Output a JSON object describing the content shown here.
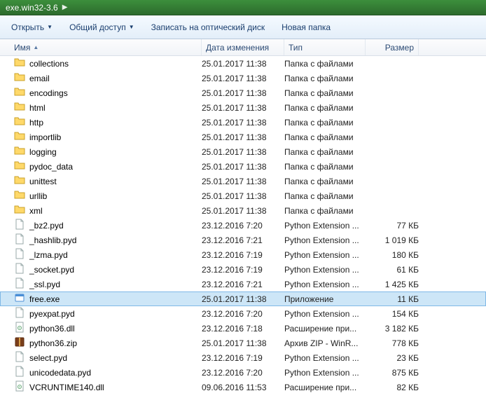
{
  "breadcrumb": {
    "current": "exe.win32-3.6"
  },
  "toolbar": {
    "open": "Открыть",
    "share": "Общий доступ",
    "burn": "Записать на оптический диск",
    "new_folder": "Новая папка"
  },
  "columns": {
    "name": "Имя",
    "date": "Дата изменения",
    "type": "Тип",
    "size": "Размер"
  },
  "rows": [
    {
      "icon": "folder",
      "name": "collections",
      "date": "25.01.2017 11:38",
      "type": "Папка с файлами",
      "size": ""
    },
    {
      "icon": "folder",
      "name": "email",
      "date": "25.01.2017 11:38",
      "type": "Папка с файлами",
      "size": ""
    },
    {
      "icon": "folder",
      "name": "encodings",
      "date": "25.01.2017 11:38",
      "type": "Папка с файлами",
      "size": ""
    },
    {
      "icon": "folder",
      "name": "html",
      "date": "25.01.2017 11:38",
      "type": "Папка с файлами",
      "size": ""
    },
    {
      "icon": "folder",
      "name": "http",
      "date": "25.01.2017 11:38",
      "type": "Папка с файлами",
      "size": ""
    },
    {
      "icon": "folder",
      "name": "importlib",
      "date": "25.01.2017 11:38",
      "type": "Папка с файлами",
      "size": ""
    },
    {
      "icon": "folder",
      "name": "logging",
      "date": "25.01.2017 11:38",
      "type": "Папка с файлами",
      "size": ""
    },
    {
      "icon": "folder",
      "name": "pydoc_data",
      "date": "25.01.2017 11:38",
      "type": "Папка с файлами",
      "size": ""
    },
    {
      "icon": "folder",
      "name": "unittest",
      "date": "25.01.2017 11:38",
      "type": "Папка с файлами",
      "size": ""
    },
    {
      "icon": "folder",
      "name": "urllib",
      "date": "25.01.2017 11:38",
      "type": "Папка с файлами",
      "size": ""
    },
    {
      "icon": "folder",
      "name": "xml",
      "date": "25.01.2017 11:38",
      "type": "Папка с файлами",
      "size": ""
    },
    {
      "icon": "pyd",
      "name": "_bz2.pyd",
      "date": "23.12.2016 7:20",
      "type": "Python Extension ...",
      "size": "77 КБ"
    },
    {
      "icon": "pyd",
      "name": "_hashlib.pyd",
      "date": "23.12.2016 7:21",
      "type": "Python Extension ...",
      "size": "1 019 КБ"
    },
    {
      "icon": "pyd",
      "name": "_lzma.pyd",
      "date": "23.12.2016 7:19",
      "type": "Python Extension ...",
      "size": "180 КБ"
    },
    {
      "icon": "pyd",
      "name": "_socket.pyd",
      "date": "23.12.2016 7:19",
      "type": "Python Extension ...",
      "size": "61 КБ"
    },
    {
      "icon": "pyd",
      "name": "_ssl.pyd",
      "date": "23.12.2016 7:21",
      "type": "Python Extension ...",
      "size": "1 425 КБ"
    },
    {
      "icon": "exe",
      "name": "free.exe",
      "date": "25.01.2017 11:38",
      "type": "Приложение",
      "size": "11 КБ",
      "selected": true
    },
    {
      "icon": "pyd",
      "name": "pyexpat.pyd",
      "date": "23.12.2016 7:20",
      "type": "Python Extension ...",
      "size": "154 КБ"
    },
    {
      "icon": "dll",
      "name": "python36.dll",
      "date": "23.12.2016 7:18",
      "type": "Расширение при...",
      "size": "3 182 КБ"
    },
    {
      "icon": "zip",
      "name": "python36.zip",
      "date": "25.01.2017 11:38",
      "type": "Архив ZIP - WinR...",
      "size": "778 КБ"
    },
    {
      "icon": "pyd",
      "name": "select.pyd",
      "date": "23.12.2016 7:19",
      "type": "Python Extension ...",
      "size": "23 КБ"
    },
    {
      "icon": "pyd",
      "name": "unicodedata.pyd",
      "date": "23.12.2016 7:20",
      "type": "Python Extension ...",
      "size": "875 КБ"
    },
    {
      "icon": "dll",
      "name": "VCRUNTIME140.dll",
      "date": "09.06.2016 11:53",
      "type": "Расширение при...",
      "size": "82 КБ"
    }
  ]
}
